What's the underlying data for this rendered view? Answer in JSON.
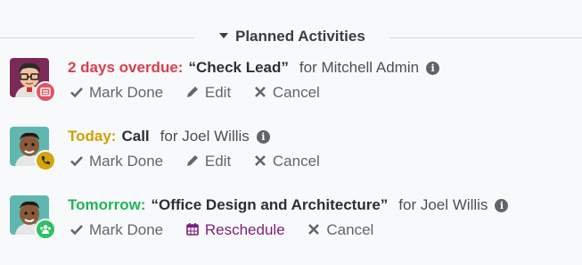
{
  "section": {
    "title": "Planned Activities"
  },
  "colors": {
    "overdue": "#d9404b",
    "today": "#d0a000",
    "tomorrow": "#21b55a",
    "reschedule": "#7c1f7a",
    "badge_email": "#e25563",
    "badge_call": "#d4a40c",
    "badge_meeting": "#2ec164"
  },
  "activities": [
    {
      "when": "2 days overdue:",
      "summary": "“Check Lead”",
      "assignee": "for Mitchell Admin",
      "badge_icon": "email-icon",
      "actions": {
        "done": "Mark Done",
        "edit": "Edit",
        "cancel": "Cancel"
      }
    },
    {
      "when": "Today:",
      "summary": "Call",
      "assignee": "for Joel Willis",
      "badge_icon": "phone-icon",
      "actions": {
        "done": "Mark Done",
        "edit": "Edit",
        "cancel": "Cancel"
      }
    },
    {
      "when": "Tomorrow:",
      "summary": "“Office Design and Architecture”",
      "assignee": "for Joel Willis",
      "badge_icon": "users-icon",
      "actions": {
        "done": "Mark Done",
        "reschedule": "Reschedule",
        "cancel": "Cancel"
      }
    }
  ]
}
